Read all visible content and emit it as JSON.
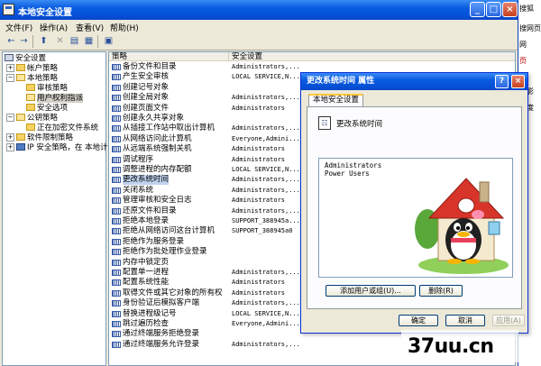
{
  "window": {
    "title": "本地安全设置",
    "controls": {
      "minimize": "_",
      "maximize": "□",
      "close": "×"
    }
  },
  "menu": [
    "文件(F)",
    "操作(A)",
    "查看(V)",
    "帮助(H)"
  ],
  "toolbar": {
    "icons": [
      "back-arrow-icon",
      "forward-arrow-icon",
      "up-folder-icon",
      "delete-icon",
      "properties-icon",
      "export-list-icon",
      "help-icon"
    ]
  },
  "tree": [
    {
      "label": "安全设置",
      "icon": "computer-icon",
      "expander": "",
      "level": 0
    },
    {
      "label": "帐户策略",
      "icon": "folder-icon",
      "expander": "+",
      "level": 1
    },
    {
      "label": "本地策略",
      "icon": "folder-open-icon",
      "expander": "−",
      "level": 1
    },
    {
      "label": "审核策略",
      "icon": "folder-icon",
      "expander": "",
      "level": 2
    },
    {
      "label": "用户权利指派",
      "icon": "folder-open-icon",
      "expander": "",
      "level": 2
    },
    {
      "label": "安全选项",
      "icon": "folder-icon",
      "expander": "",
      "level": 2
    },
    {
      "label": "公钥策略",
      "icon": "folder-open-icon",
      "expander": "−",
      "level": 1
    },
    {
      "label": "正在加密文件系统",
      "icon": "folder-icon",
      "expander": "",
      "level": 2
    },
    {
      "label": "软件限制策略",
      "icon": "folder-icon",
      "expander": "+",
      "level": 1
    },
    {
      "label": "IP 安全策略，在 本地计",
      "icon": "ipsec-icon",
      "expander": "+",
      "level": 1
    }
  ],
  "list": {
    "columns": [
      "策略",
      "安全设置"
    ],
    "rows": [
      {
        "name": "备份文件和目录",
        "value": "Administrators,..."
      },
      {
        "name": "产生安全审核",
        "value": "LOCAL SERVICE,N..."
      },
      {
        "name": "创建记号对象",
        "value": ""
      },
      {
        "name": "创建全局对象",
        "value": "Administrators,..."
      },
      {
        "name": "创建页面文件",
        "value": "Administrators"
      },
      {
        "name": "创建永久共享对象",
        "value": ""
      },
      {
        "name": "从插接工作站中取出计算机",
        "value": "Administrators,..."
      },
      {
        "name": "从网络访问此计算机",
        "value": "Everyone,Admini..."
      },
      {
        "name": "从远端系统强制关机",
        "value": "Administrators"
      },
      {
        "name": "调试程序",
        "value": "Administrators"
      },
      {
        "name": "调整进程的内存配额",
        "value": "LOCAL SERVICE,N..."
      },
      {
        "name": "更改系统时间",
        "value": "Administrators,...",
        "selected": true
      },
      {
        "name": "关闭系统",
        "value": "Administrators,..."
      },
      {
        "name": "管理审核和安全日志",
        "value": "Administrators"
      },
      {
        "name": "还原文件和目录",
        "value": "Administrators,..."
      },
      {
        "name": "拒绝本地登录",
        "value": "SUPPORT_388945a..."
      },
      {
        "name": "拒绝从网络访问这台计算机",
        "value": "SUPPORT_388945a0"
      },
      {
        "name": "拒绝作为服务登录",
        "value": ""
      },
      {
        "name": "拒绝作为批处理作业登录",
        "value": ""
      },
      {
        "name": "内存中锁定页",
        "value": ""
      },
      {
        "name": "配置单一进程",
        "value": "Administrators,..."
      },
      {
        "name": "配置系统性能",
        "value": "Administrators"
      },
      {
        "name": "取得文件或其它对象的所有权",
        "value": "Administrators"
      },
      {
        "name": "身份验证后模拟客户端",
        "value": "Administrators,..."
      },
      {
        "name": "替换进程级记号",
        "value": "LOCAL SERVICE,N..."
      },
      {
        "name": "跳过遍历检查",
        "value": "Everyone,Admini..."
      },
      {
        "name": "通过终端服务拒绝登录",
        "value": ""
      },
      {
        "name": "通过终端服务允许登录",
        "value": "Administrators,..."
      }
    ]
  },
  "dialog": {
    "title": "更改系统时间 属性",
    "help": "?",
    "close": "×",
    "tab": "本地安全设置",
    "policy_name": "更改系统时间",
    "policy_icon": "policy-document-icon",
    "users": [
      "Administrators",
      "Power Users"
    ],
    "add_button": "添加用户或组(U)...",
    "remove_button": "删除(R)",
    "ok_button": "确定",
    "cancel_button": "取消",
    "apply_button": "应用(A)"
  },
  "background_strip": [
    "搜狐",
    "搜网页",
    "网",
    "页",
    "电影",
    "速度"
  ],
  "watermark": "37uu.cn"
}
